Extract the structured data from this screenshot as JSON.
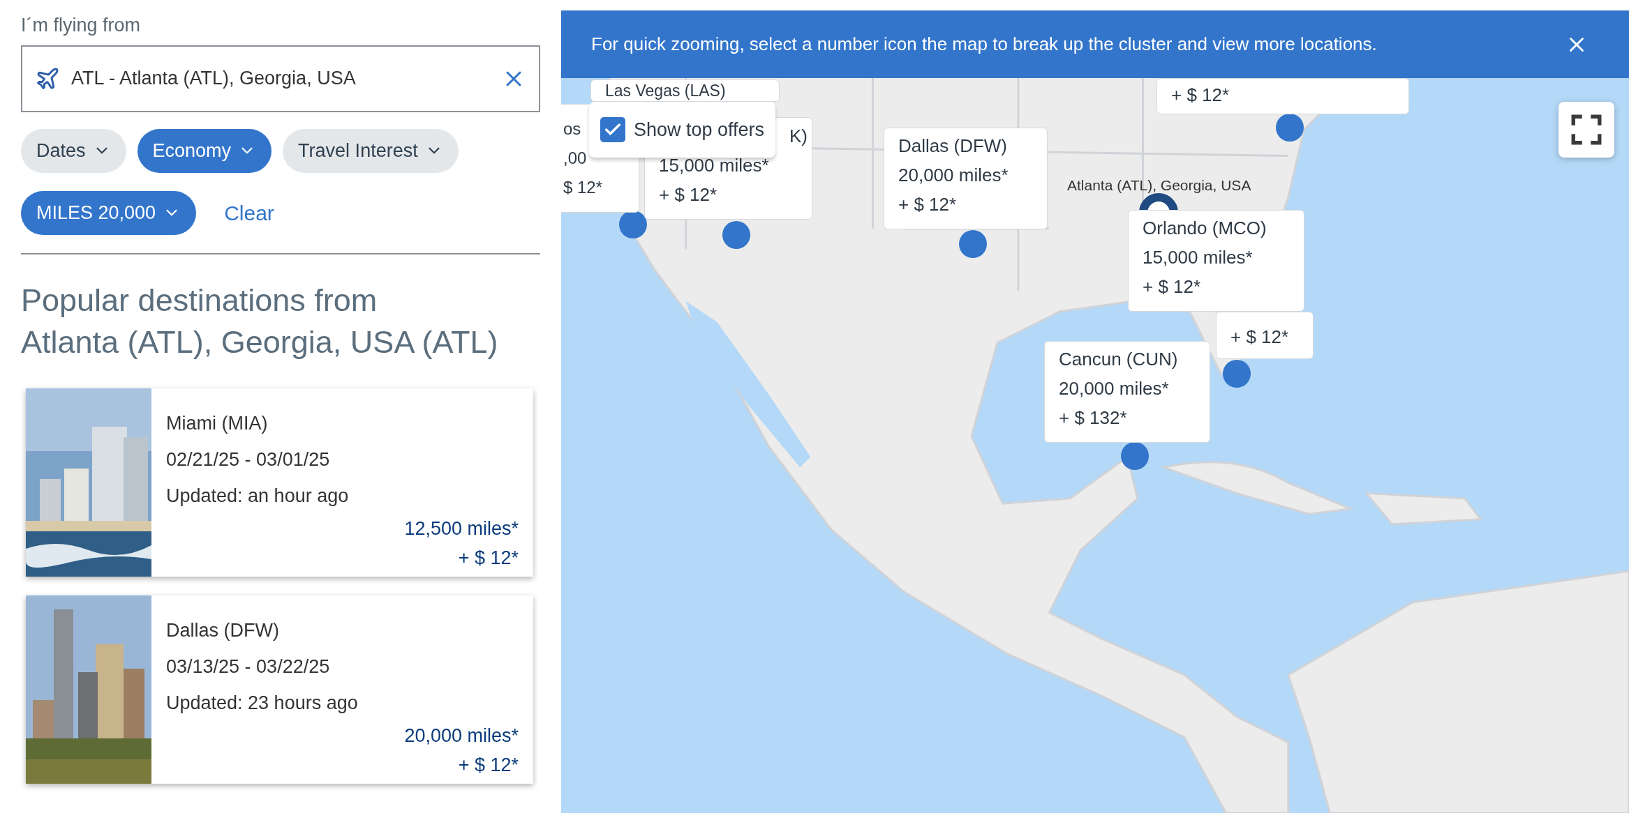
{
  "origin": {
    "label": "I´m flying from",
    "value": "ATL - Atlanta (ATL), Georgia, USA"
  },
  "filters": [
    {
      "kind": "dropdown",
      "label": "Dates",
      "selected": false
    },
    {
      "kind": "dropdown",
      "label": "Economy",
      "selected": true
    },
    {
      "kind": "dropdown",
      "label": "Travel Interest",
      "selected": false
    },
    {
      "kind": "dropdown",
      "label": "MILES 20,000",
      "selected": true
    },
    {
      "kind": "link",
      "label": "Clear"
    }
  ],
  "heading": [
    "Popular destinations from",
    "Atlanta (ATL), Georgia, USA (ATL)"
  ],
  "destinations": [
    {
      "name": "Miami (MIA)",
      "dates": "02/21/25 - 03/01/25",
      "updated": "Updated: an hour ago",
      "miles": "12,500 miles*",
      "fare": "+ $ 12*"
    },
    {
      "name": "Dallas (DFW)",
      "dates": "03/13/25 - 03/22/25",
      "updated": "Updated: 23 hours ago",
      "miles": "20,000 miles*",
      "fare": "+ $ 12*"
    }
  ],
  "map": {
    "banner": "For quick zooming, select a number icon the map to break up the cluster and view more locations.",
    "top_offers": {
      "label": "Show top offers",
      "checked": true
    },
    "origin_label": "Atlanta (ATL), Georgia, USA",
    "offer_cards": [
      {
        "lines": [
          "os",
          ",00",
          "$ 12*"
        ]
      },
      {
        "lines": [
          "Las Vegas (LAS)"
        ]
      },
      {
        "lines": [
          "K)",
          "15,000 miles*",
          "+ $ 12*"
        ]
      },
      {
        "lines": [
          "Dallas (DFW)",
          "20,000 miles*",
          "+ $ 12*"
        ]
      },
      {
        "lines": [
          "+ $ 12*"
        ]
      },
      {
        "lines": [
          "+ $ 12*"
        ]
      },
      {
        "lines": [
          "Orlando (MCO)",
          "15,000 miles*",
          "+ $ 12*"
        ]
      },
      {
        "lines": [
          "Cancun (CUN)",
          "20,000 miles*",
          "+ $ 132*"
        ]
      }
    ]
  }
}
